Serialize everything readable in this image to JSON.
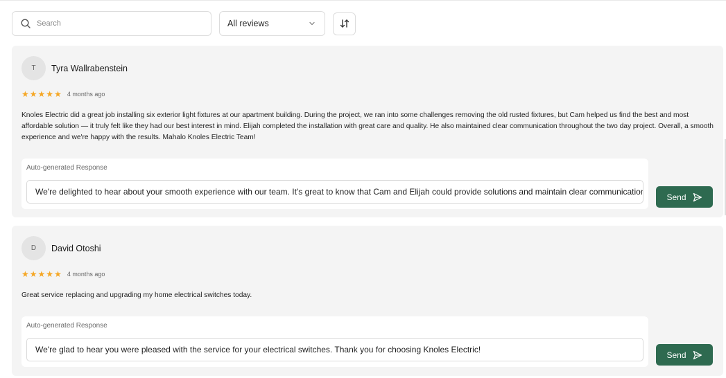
{
  "toolbar": {
    "search_placeholder": "Search",
    "filter_selected": "All reviews",
    "icons": {
      "search": "search-icon",
      "dropdown": "chevron-down-icon",
      "sort": "sort-arrows-icon"
    }
  },
  "reviews": [
    {
      "avatar_initial": "T",
      "name": "Tyra Wallrabenstein",
      "rating": 5,
      "time": "4 months ago",
      "text": "Knoles Electric did a great job installing six exterior light fixtures at our apartment building. During the project, we ran into some challenges removing the old rusted fixtures, but Cam helped us find the best and most affordable solution — it truly felt like they had our best interest in mind. Elijah completed the installation with great care and quality. He also maintained clear communication throughout the two day project. Overall, a smooth experience and we're happy with the results. Mahalo Knoles Electric Team!",
      "response_label": "Auto-generated Response",
      "response_text": "We're delighted to hear about your smooth experience with our team. It's great to know that Cam and Elijah could provide solutions and maintain clear communication throughout the project.",
      "send_label": "Send"
    },
    {
      "avatar_initial": "D",
      "name": "David Otoshi",
      "rating": 5,
      "time": "4 months ago",
      "text": "Great service replacing and upgrading my home electrical switches today.",
      "response_label": "Auto-generated Response",
      "response_text": "We're glad to hear you were pleased with the service for your electrical switches. Thank you for choosing Knoles Electric!",
      "send_label": "Send"
    }
  ],
  "colors": {
    "accent": "#2e6a50",
    "star": "#f5a623",
    "card_bg": "#f4f4f4"
  }
}
